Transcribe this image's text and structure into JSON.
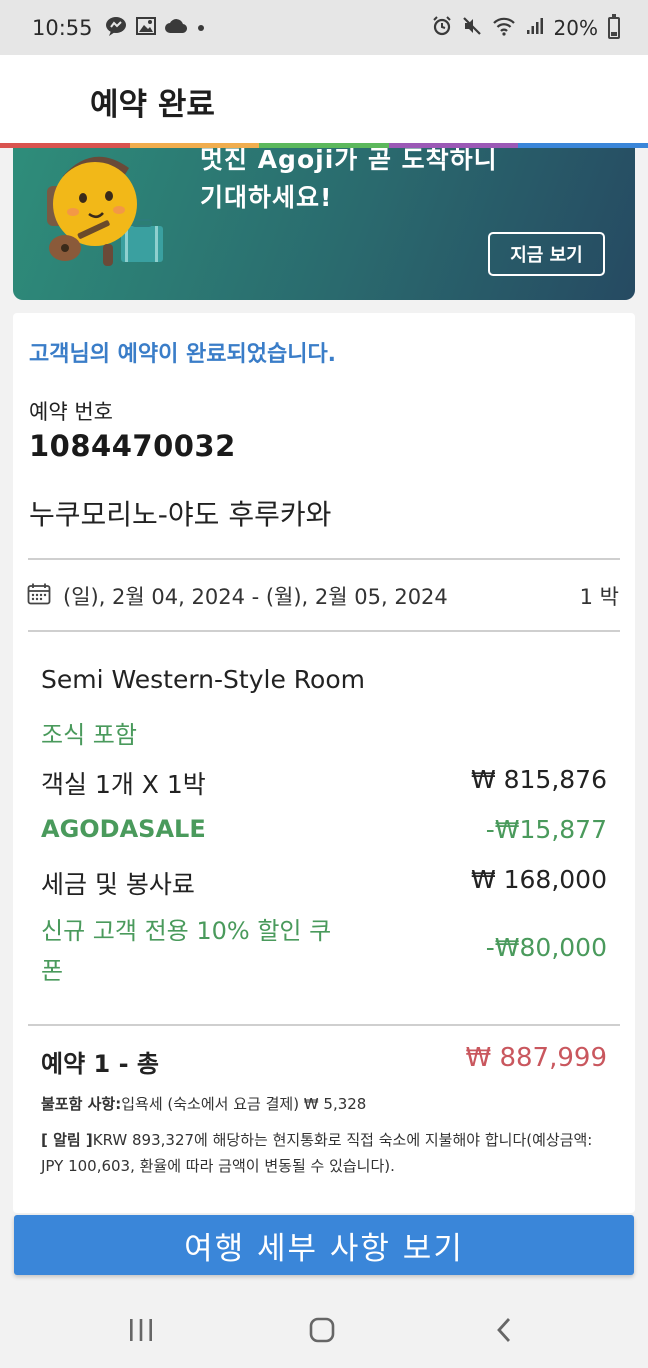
{
  "status_bar": {
    "time": "10:55",
    "battery": "20%",
    "left_icons": [
      "messenger-icon",
      "image-icon",
      "cloud-icon",
      "dot-icon"
    ],
    "right_icons": [
      "alarm-icon",
      "mute-icon",
      "wifi-icon",
      "signal-icon",
      "battery-icon"
    ]
  },
  "header": {
    "title": "예약 완료",
    "rainbow_colors": [
      "#d9534f",
      "#f0ad4e",
      "#5cb85c",
      "#9b59b6",
      "#3a86d9"
    ]
  },
  "promo": {
    "line1": "멋진 Agoji가 곧 도착하니",
    "line2": "기대하세요!",
    "button": "지금 보기"
  },
  "confirmation": {
    "message": "고객님의 예약이 완료되었습니다.",
    "booking_label": "예약 번호",
    "booking_number": "1084470032",
    "hotel_name": "누쿠모리노-야도 후루카와",
    "dates": "(일), 2월 04, 2024 - (월), 2월 05, 2024",
    "nights": "1 박"
  },
  "room": {
    "name": "Semi Western-Style Room",
    "breakfast": "조식 포함",
    "rows": [
      {
        "label": "객실 1개 X 1박",
        "value": "₩ 815,876"
      },
      {
        "label": "AGODASALE",
        "value": "-₩15,877"
      },
      {
        "label": "세금 및 봉사료",
        "value": "₩ 168,000"
      }
    ],
    "coupon_label": "신규 고객 전용 10% 할인 쿠폰",
    "coupon_value": "-₩80,000"
  },
  "total": {
    "label": "예약 1 - 총",
    "value": "₩ 887,999",
    "excluded_label": "불포함 사항:",
    "excluded_text": "입욕세 (숙소에서 요금 결제) ₩ 5,328",
    "notice_label": "[ 알림 ]",
    "notice_text": "KRW 893,327에 해당하는 현지통화로 직접 숙소에 지불해야 합니다(예상금액: JPY 100,603, 환율에 따라 금액이 변동될 수 있습니다)."
  },
  "cta": {
    "label": "여행 세부 사항 보기"
  },
  "colors": {
    "accent_blue": "#3a86d9",
    "discount_green": "#4a9a5c",
    "total_red": "#c9575e"
  }
}
